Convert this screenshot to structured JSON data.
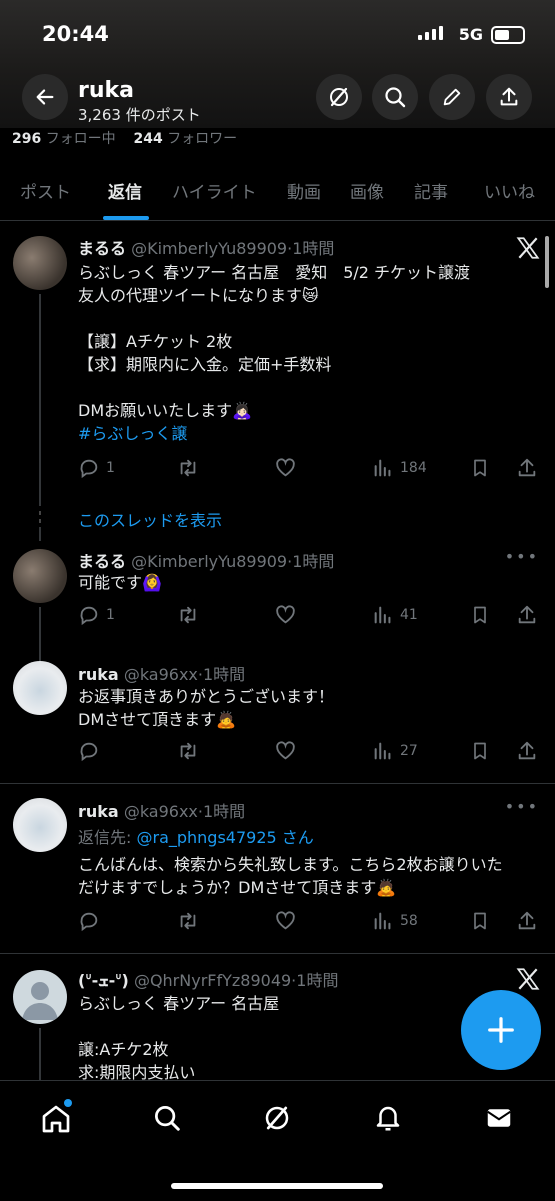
{
  "status": {
    "time": "20:44",
    "network": "5G"
  },
  "header": {
    "name": "ruka",
    "post_count": "3,263 件のポスト"
  },
  "stats": {
    "following_count": "296",
    "following_label": "フォロー中",
    "followers_count": "244",
    "followers_label": "フォロワー"
  },
  "tabs": [
    {
      "label": "ポスト"
    },
    {
      "label": "返信"
    },
    {
      "label": "ハイライト"
    },
    {
      "label": "動画"
    },
    {
      "label": "画像"
    },
    {
      "label": "記事"
    },
    {
      "label": "いいね"
    }
  ],
  "active_tab": "返信",
  "tweets": [
    {
      "name": "まるる",
      "handle": "@KimberlyYu89909",
      "time": "1時間",
      "lines": [
        "らぶしっく 春ツアー 名古屋　愛知　5/2 チケット譲渡",
        "友人の代理ツイートになります😿",
        "",
        "【譲】Aチケット 2枚",
        "【求】期限内に入金。定価+手数料",
        "",
        "DMお願いいたします🙇🏻‍♀️"
      ],
      "hashtag": "#らぶしっく譲",
      "replies": "1",
      "retweets": "",
      "likes": "",
      "views": "184"
    },
    {
      "name": "まるる",
      "handle": "@KimberlyYu89909",
      "time": "1時間",
      "lines": [
        "可能です🙆‍♀️"
      ],
      "replies": "1",
      "retweets": "",
      "likes": "",
      "views": "41"
    },
    {
      "name": "ruka",
      "handle": "@ka96xx",
      "time": "1時間",
      "lines": [
        "お返事頂きありがとうございます！",
        "DMさせて頂きます🙇"
      ],
      "replies": "",
      "retweets": "",
      "likes": "",
      "views": "27"
    },
    {
      "name": "ruka",
      "handle": "@ka96xx",
      "time": "1時間",
      "reply_to_prefix": "返信先: ",
      "reply_to_user": "@ra_phngs47925 さん",
      "lines": [
        "こんばんは、検索から失礼致します。こちら2枚お譲りいた",
        "だけますでしょうか？DMさせて頂きます🙇"
      ],
      "replies": "",
      "retweets": "",
      "likes": "",
      "views": "58"
    },
    {
      "name": "(ᐡ-ܫ-ᐡ)",
      "handle": "@QhrNyrFfYz89049",
      "time": "1時間",
      "lines": [
        "らぶしっく 春ツアー 名古屋",
        "",
        "譲:Aチケ2枚",
        "求:期限内支払い"
      ]
    }
  ],
  "show_thread": "このスレッドを表示",
  "time_separator": "·",
  "colors": {
    "accent": "#1d9bf0",
    "muted": "#71767b",
    "text": "#e7e9ea",
    "background": "#000000"
  },
  "icons": [
    "back-arrow-icon",
    "grok-icon",
    "search-icon",
    "pen-icon",
    "share-icon",
    "x-logo-icon",
    "reply-icon",
    "retweet-icon",
    "heart-icon",
    "views-icon",
    "bookmark-icon",
    "more-dots-icon",
    "plus-icon",
    "home-icon",
    "bell-icon",
    "mail-icon"
  ]
}
